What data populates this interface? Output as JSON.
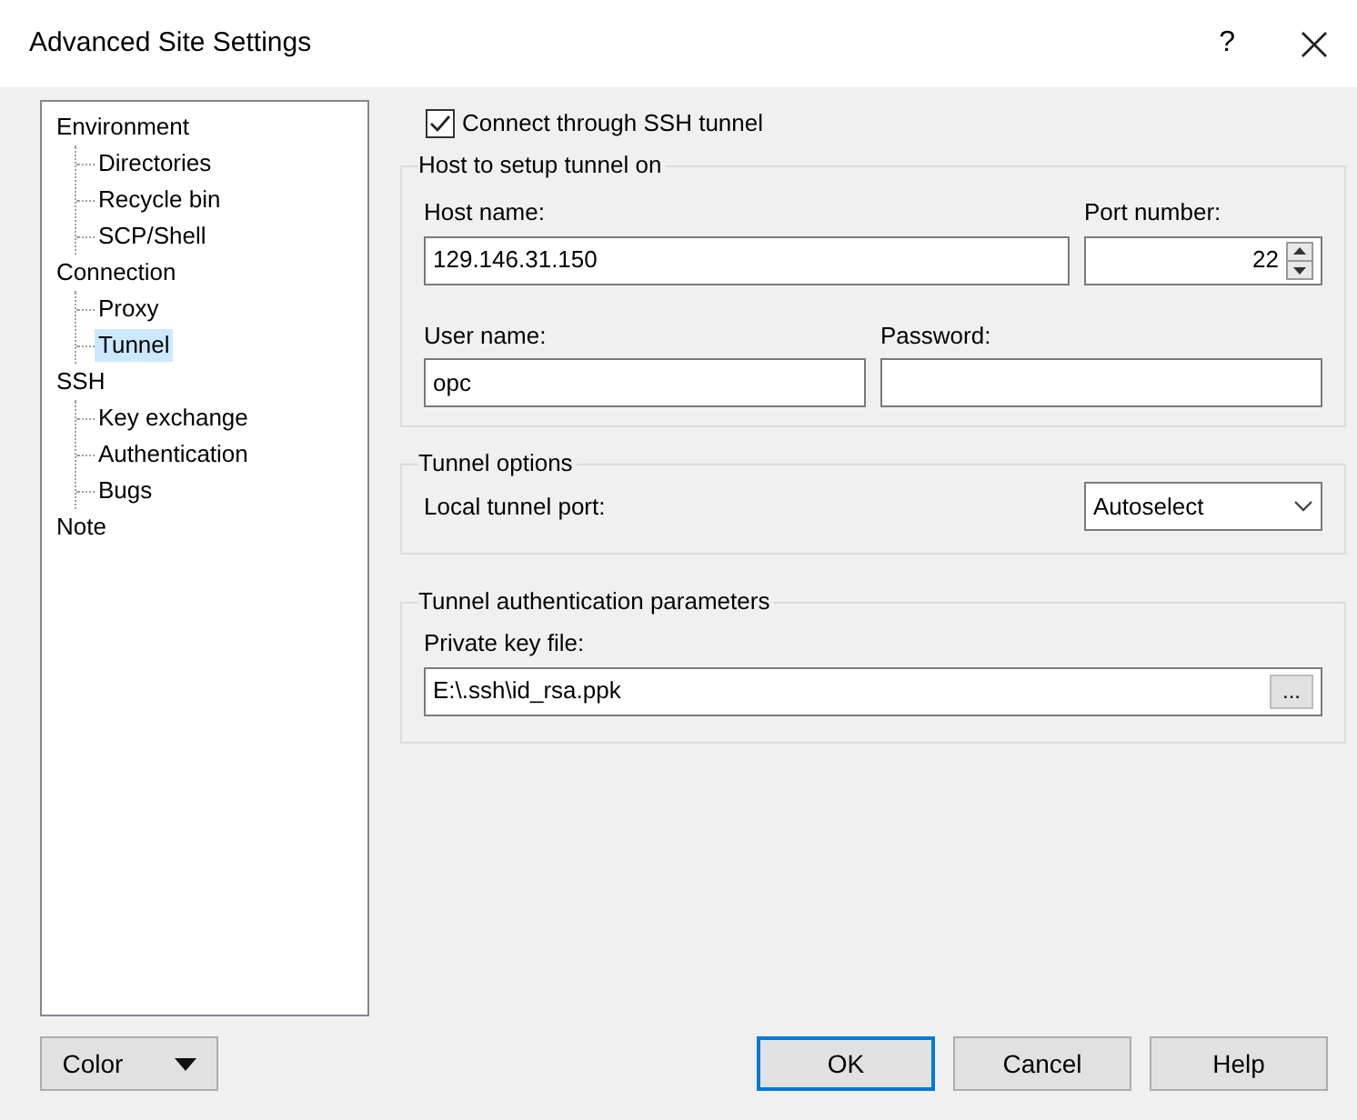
{
  "window": {
    "title": "Advanced Site Settings",
    "help_button": "?"
  },
  "tree": [
    {
      "label": "Environment",
      "selected": false,
      "children": [
        {
          "label": "Directories",
          "selected": false
        },
        {
          "label": "Recycle bin",
          "selected": false
        },
        {
          "label": "SCP/Shell",
          "selected": false
        }
      ]
    },
    {
      "label": "Connection",
      "selected": false,
      "children": [
        {
          "label": "Proxy",
          "selected": false
        },
        {
          "label": "Tunnel",
          "selected": true
        }
      ]
    },
    {
      "label": "SSH",
      "selected": false,
      "children": [
        {
          "label": "Key exchange",
          "selected": false
        },
        {
          "label": "Authentication",
          "selected": false
        },
        {
          "label": "Bugs",
          "selected": false
        }
      ]
    },
    {
      "label": "Note",
      "selected": false
    }
  ],
  "ssh_tunnel": {
    "label": "Connect through SSH tunnel",
    "checked": true
  },
  "host_group": {
    "title": "Host to setup tunnel on",
    "host_name": {
      "label": "Host name:",
      "value": "129.146.31.150"
    },
    "port_number": {
      "label": "Port number:",
      "value": "22"
    },
    "user_name": {
      "label": "User name:",
      "value": "opc"
    },
    "password": {
      "label": "Password:"
    }
  },
  "tunnel_options": {
    "title": "Tunnel options",
    "local_port": {
      "label": "Local tunnel port:",
      "value": "Autoselect"
    }
  },
  "auth_group": {
    "title": "Tunnel authentication parameters",
    "key_file": {
      "label": "Private key file:",
      "value": "E:\\.ssh\\id_rsa.ppk"
    },
    "browse_button": "..."
  },
  "buttons": [
    {
      "label": "Color",
      "kind": "dropdown"
    },
    {
      "label": "OK",
      "kind": "default"
    },
    {
      "label": "Cancel",
      "kind": "plain"
    },
    {
      "label": "Help",
      "kind": "plain"
    }
  ]
}
